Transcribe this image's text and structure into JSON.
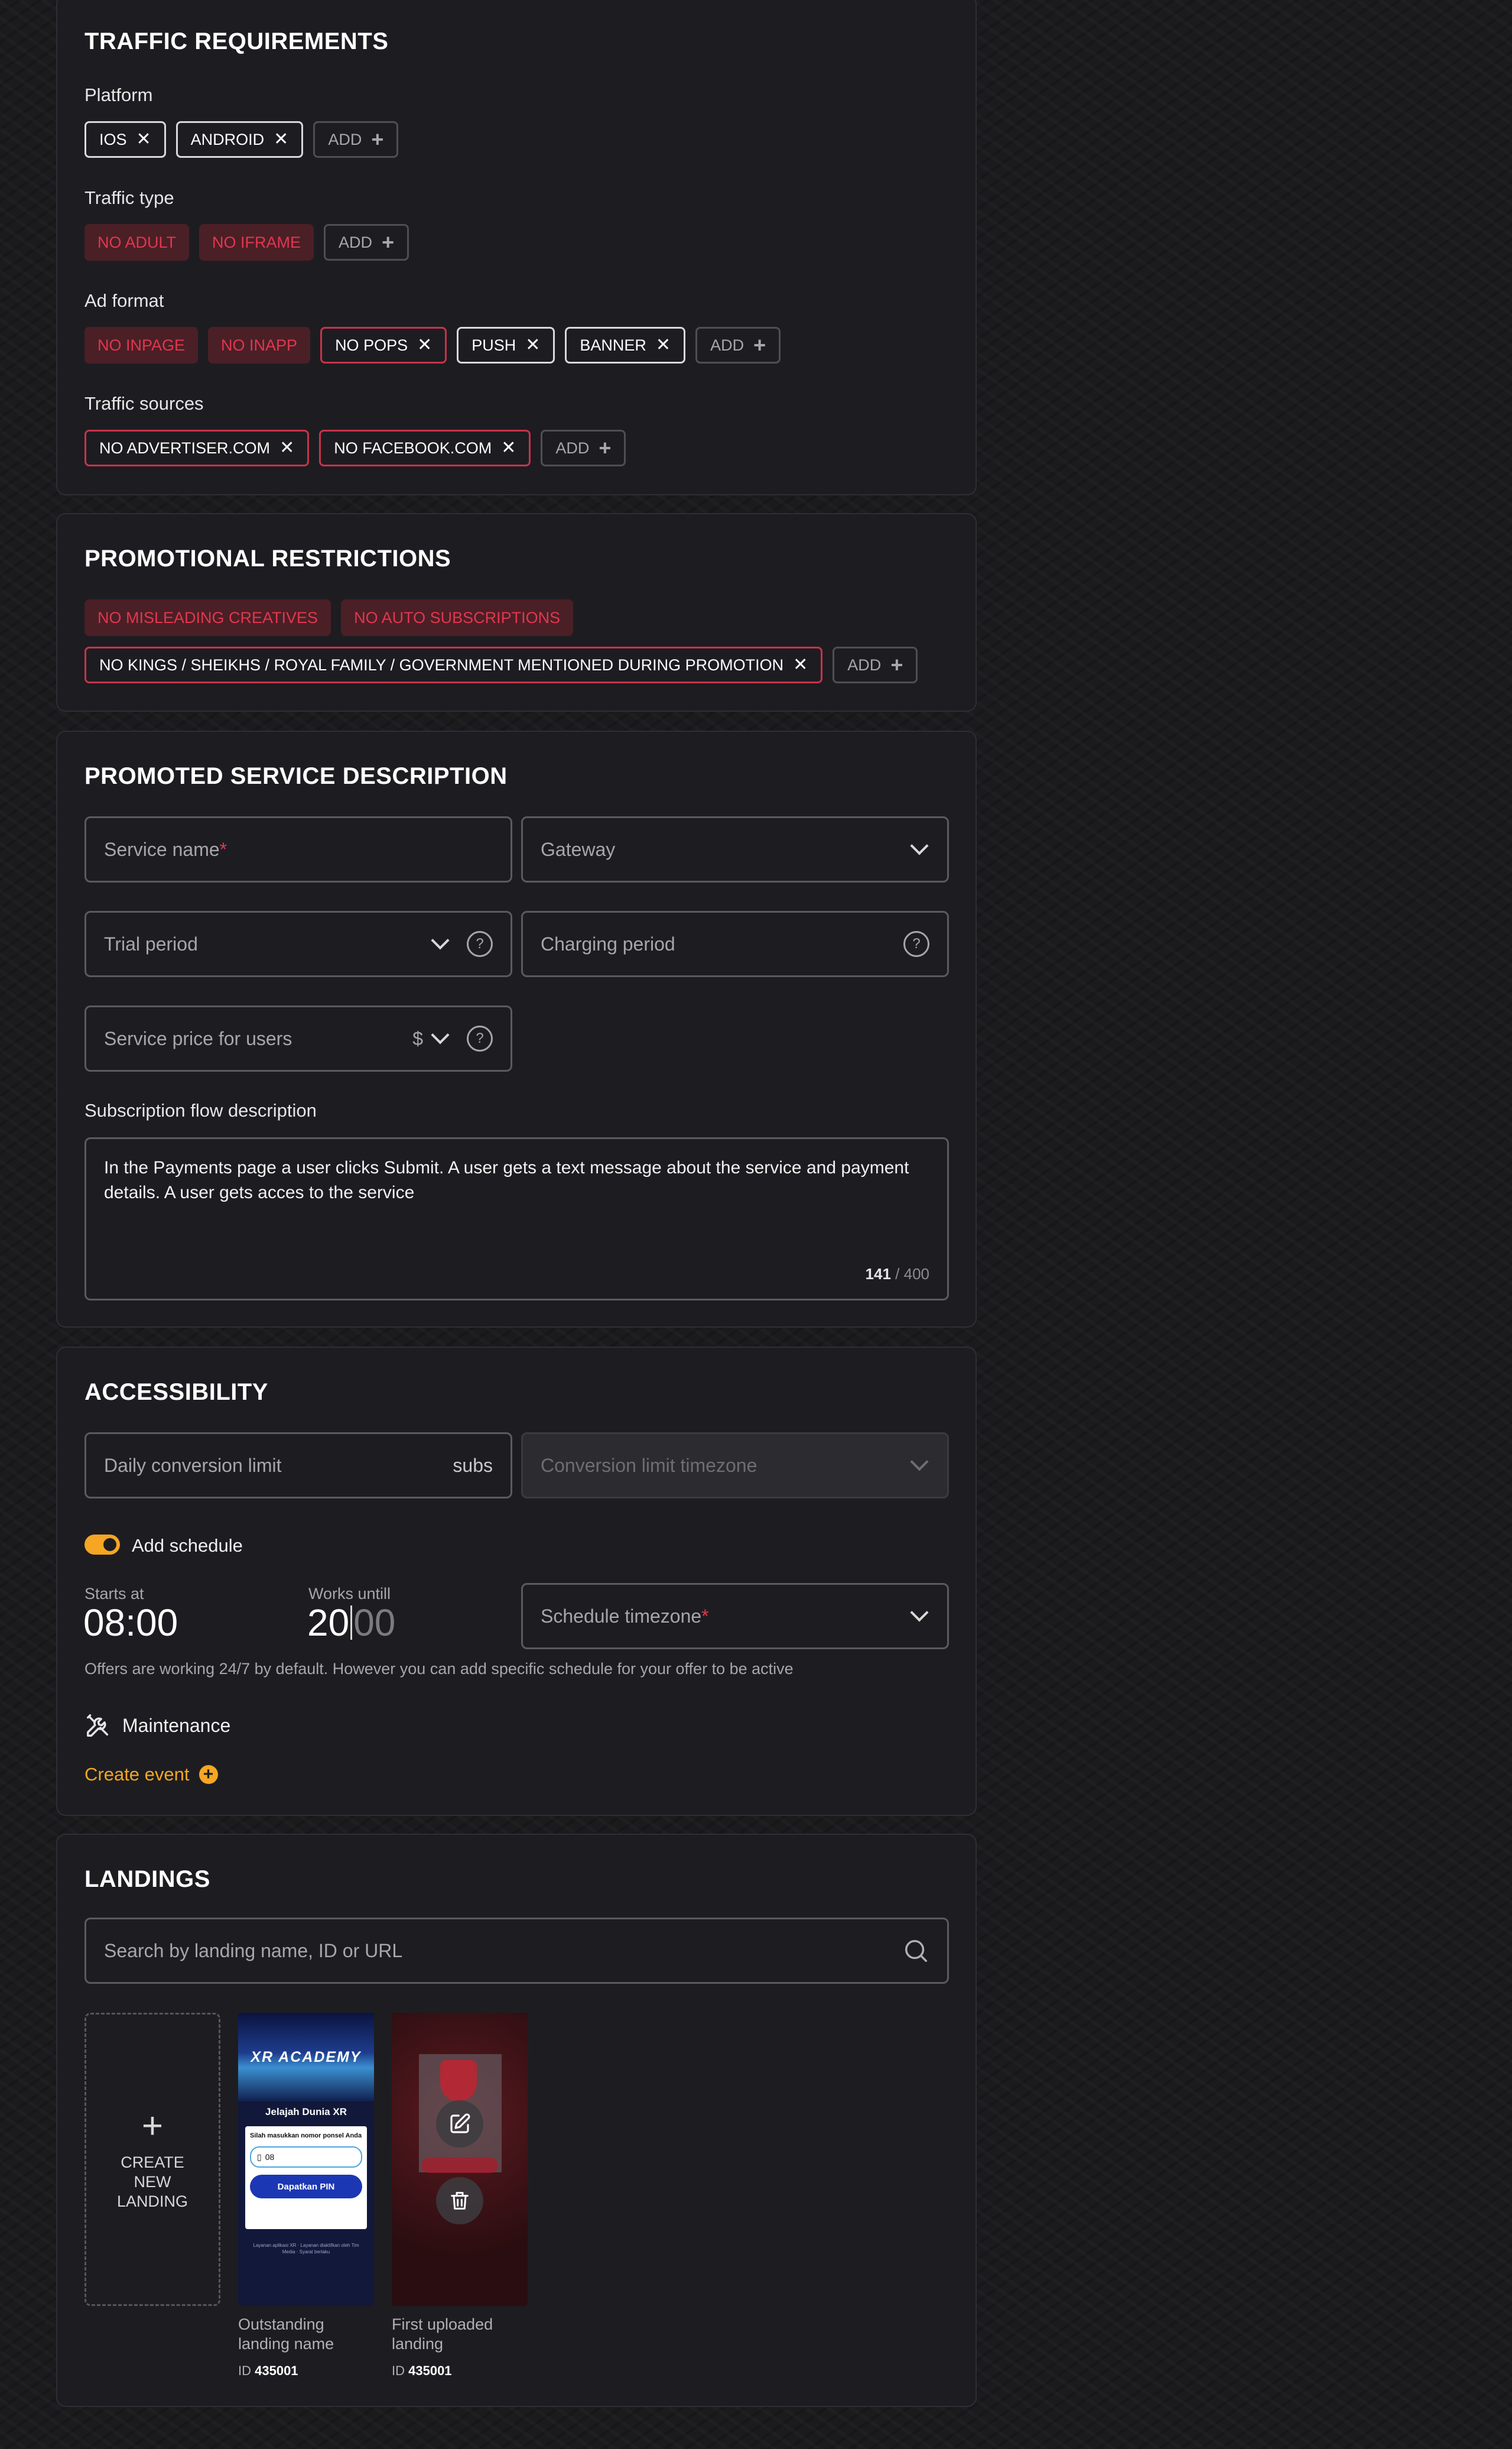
{
  "traffic": {
    "title": "TRAFFIC REQUIREMENTS",
    "platform": {
      "label": "Platform",
      "chips": [
        {
          "text": "IOS",
          "style": "white",
          "removable": true
        },
        {
          "text": "ANDROID",
          "style": "white",
          "removable": true
        }
      ],
      "add_label": "ADD"
    },
    "traffic_type": {
      "label": "Traffic type",
      "chips": [
        {
          "text": "NO ADULT",
          "style": "neg",
          "removable": false
        },
        {
          "text": "NO IFRAME",
          "style": "neg",
          "removable": false
        }
      ],
      "add_label": "ADD"
    },
    "ad_format": {
      "label": "Ad format",
      "chips": [
        {
          "text": "NO INPAGE",
          "style": "neg",
          "removable": false
        },
        {
          "text": "NO INAPP",
          "style": "neg",
          "removable": false
        },
        {
          "text": "NO POPS",
          "style": "red",
          "removable": true
        },
        {
          "text": "PUSH",
          "style": "white",
          "removable": true
        },
        {
          "text": "BANNER",
          "style": "white",
          "removable": true
        }
      ],
      "add_label": "ADD"
    },
    "sources": {
      "label": "Traffic sources",
      "chips": [
        {
          "text": "NO ADVERTISER.COM",
          "style": "red",
          "removable": true
        },
        {
          "text": "NO FACEBOOK.COM",
          "style": "red",
          "removable": true
        }
      ],
      "add_label": "ADD"
    }
  },
  "promo": {
    "title": "PROMOTIONAL RESTRICTIONS",
    "row1": [
      {
        "text": "NO MISLEADING CREATIVES",
        "style": "neg",
        "removable": false
      },
      {
        "text": "NO AUTO SUBSCRIPTIONS",
        "style": "neg",
        "removable": false
      }
    ],
    "row2": [
      {
        "text": "NO KINGS / SHEIKHS / ROYAL FAMILY / GOVERNMENT MENTIONED DURING PROMOTION",
        "style": "red",
        "removable": true
      }
    ],
    "add_label": "ADD"
  },
  "service": {
    "title": "PROMOTED SERVICE DESCRIPTION",
    "service_name": "Service name",
    "gateway": "Gateway",
    "trial_period": "Trial period",
    "charging_period": "Charging period",
    "service_price": "Service price for users",
    "currency": "$",
    "help_glyph": "?",
    "flow_label": "Subscription flow description",
    "flow_text": "In the Payments page a user clicks Submit. A user gets a text message about the service and payment details. A user gets acces to the service",
    "char_count": "141",
    "char_max": "/ 400"
  },
  "access": {
    "title": "ACCESSIBILITY",
    "daily_limit": "Daily conversion limit",
    "daily_limit_unit": "subs",
    "limit_tz": "Conversion limit timezone",
    "schedule_label": "Add schedule",
    "schedule_enabled": true,
    "starts_label": "Starts at",
    "starts_value": "08:00",
    "works_label": "Works untill",
    "works_hours": "20",
    "works_minutes": "00",
    "schedule_tz": "Schedule timezone",
    "note": "Offers are working 24/7 by default. However you can add specific schedule for your offer to be active",
    "maintenance_label": "Maintenance",
    "create_event": "Create event"
  },
  "landings": {
    "title": "LANDINGS",
    "search_placeholder": "Search by landing name, ID or URL",
    "create_new": "CREATE NEW LANDING",
    "items": [
      {
        "name": "Outstanding landing name",
        "id_prefix": "ID",
        "id": "435001",
        "preview": {
          "brand": "XR ACADEMY",
          "heading": "Jelajah Dunia XR",
          "prompt": "Silah masukkan nomor ponsel Anda",
          "phone": "08",
          "button": "Dapatkan PIN",
          "footer": "Layanan aplikasi XR · Layanan diaktifkan oleh Tim Media · Syarat berlaku"
        }
      },
      {
        "name": "First uploaded landing",
        "id_prefix": "ID",
        "id": "435001"
      }
    ]
  },
  "colors": {
    "accent": "#f5a623",
    "negative_text": "#e0374f",
    "negative_bg": "#4b1f26",
    "card_bg": "#1d1d21"
  }
}
